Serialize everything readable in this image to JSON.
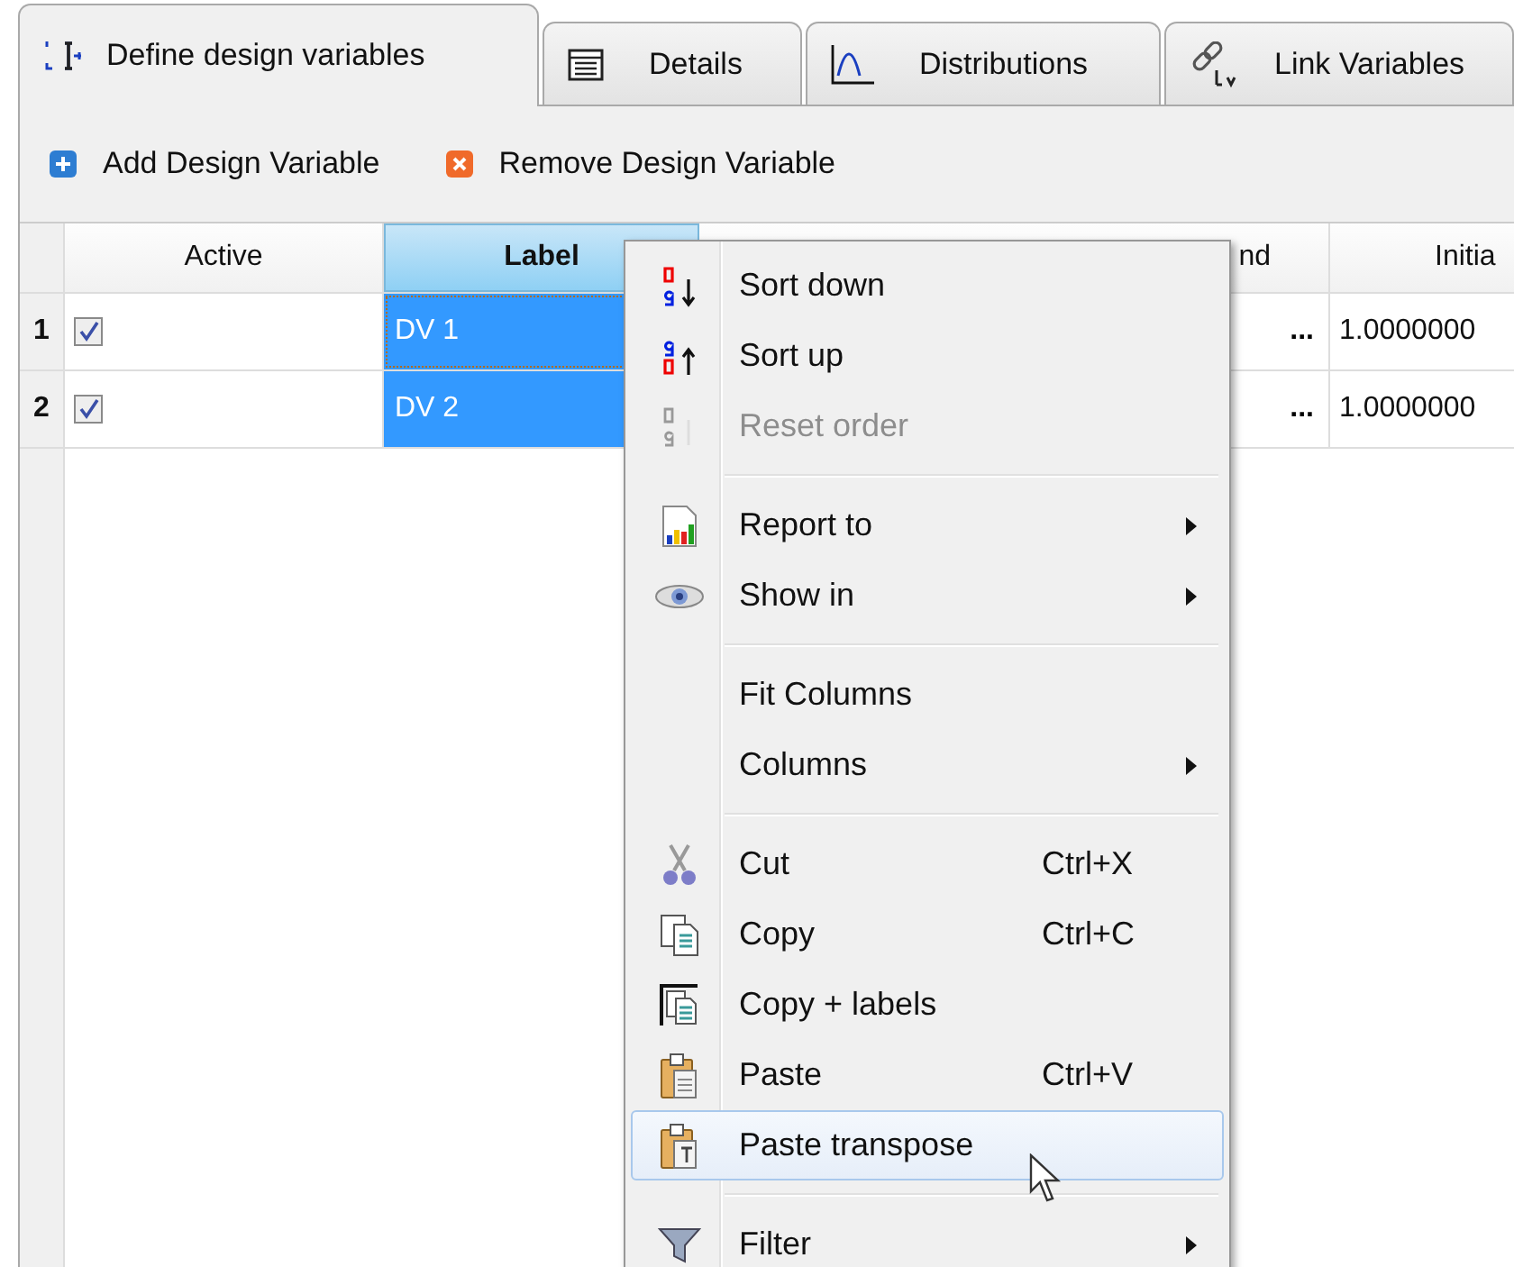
{
  "tabs": [
    {
      "label": "Define design variables",
      "selected": true
    },
    {
      "label": "Details",
      "selected": false
    },
    {
      "label": "Distributions",
      "selected": false
    },
    {
      "label": "Link Variables",
      "selected": false
    }
  ],
  "toolbar": [
    {
      "label": "Add Design Variable"
    },
    {
      "label": "Remove Design Variable"
    }
  ],
  "table": {
    "columns": [
      {
        "label": "Active",
        "selected": false
      },
      {
        "label": "Label",
        "selected": true
      },
      {
        "label": "nd",
        "selected": false
      },
      {
        "label": "Initia",
        "selected": false
      }
    ],
    "rows": [
      {
        "number": "1",
        "active": true,
        "label": "DV 1",
        "selected": true,
        "focused": true,
        "button": "...",
        "initial": "1.0000000"
      },
      {
        "number": "2",
        "active": true,
        "label": "DV 2",
        "selected": true,
        "focused": false,
        "button": "...",
        "initial": "1.0000000"
      }
    ]
  },
  "context_menu": [
    {
      "kind": "item",
      "label": "Sort down",
      "disabled": false,
      "selected": false
    },
    {
      "kind": "item",
      "label": "Sort up",
      "disabled": false,
      "selected": false
    },
    {
      "kind": "item",
      "label": "Reset order",
      "disabled": true,
      "selected": false
    },
    {
      "kind": "separator"
    },
    {
      "kind": "item",
      "label": "Report to",
      "submenu": true,
      "disabled": false,
      "selected": false
    },
    {
      "kind": "item",
      "label": "Show in",
      "submenu": true,
      "disabled": false,
      "selected": false
    },
    {
      "kind": "separator"
    },
    {
      "kind": "item",
      "label": "Fit Columns",
      "disabled": false,
      "selected": false
    },
    {
      "kind": "item",
      "label": "Columns",
      "submenu": true,
      "disabled": false,
      "selected": false
    },
    {
      "kind": "separator"
    },
    {
      "kind": "item",
      "label": "Cut",
      "shortcut": "Ctrl+X",
      "disabled": false,
      "selected": false
    },
    {
      "kind": "item",
      "label": "Copy",
      "shortcut": "Ctrl+C",
      "disabled": false,
      "selected": false
    },
    {
      "kind": "item",
      "label": "Copy + labels",
      "disabled": false,
      "selected": false
    },
    {
      "kind": "item",
      "label": "Paste",
      "shortcut": "Ctrl+V",
      "disabled": false,
      "selected": false
    },
    {
      "kind": "item",
      "label": "Paste transpose",
      "disabled": false,
      "selected": true
    },
    {
      "kind": "separator"
    },
    {
      "kind": "item",
      "label": "Filter",
      "submenu": true,
      "disabled": false,
      "selected": false
    }
  ]
}
